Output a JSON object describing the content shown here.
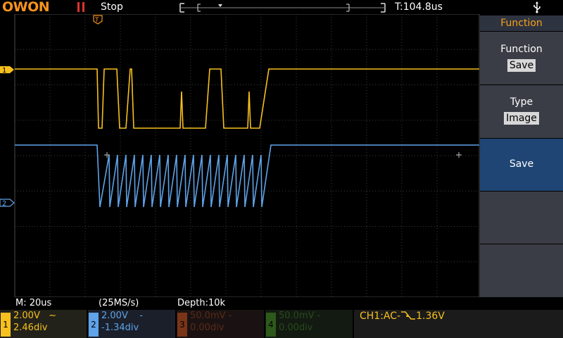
{
  "brand": "OWON",
  "run_status": "Stop",
  "trigger_time": "T:104.8us",
  "menu": {
    "title": "Function",
    "items": [
      {
        "label": "Function",
        "value": "Save"
      },
      {
        "label": "Type",
        "value": "Image"
      },
      {
        "label": "Save",
        "value": ""
      },
      {
        "label": "",
        "value": ""
      },
      {
        "label": "",
        "value": ""
      }
    ]
  },
  "timebase": "M: 20us",
  "sample_rate": "(25MS/s)",
  "depth": "Depth:10k",
  "channels": [
    {
      "num": "1",
      "volts": "2.00V",
      "coupling": "~",
      "offset": "2.46div",
      "color": "#f7c01e",
      "enabled": true
    },
    {
      "num": "2",
      "volts": "2.00V",
      "coupling": "-",
      "offset": "-1.34div",
      "color": "#5fa3e8",
      "enabled": true
    },
    {
      "num": "3",
      "volts": "50.0mV",
      "coupling": "-",
      "offset": "0.00div",
      "color": "#7a3418",
      "enabled": false
    },
    {
      "num": "4",
      "volts": "50.0mV",
      "coupling": "-",
      "offset": "0.00div",
      "color": "#2d5a1a",
      "enabled": false
    }
  ],
  "trigger_info": {
    "source": "CH1:AC-",
    "level": "1.36V"
  },
  "markers": {
    "ch1": "1",
    "ch2": "2",
    "trigger": "T"
  },
  "colors": {
    "ch1": "#f7c01e",
    "ch2": "#5fa3e8",
    "brand": "#f7931e",
    "grid": "#3c3c3c"
  }
}
